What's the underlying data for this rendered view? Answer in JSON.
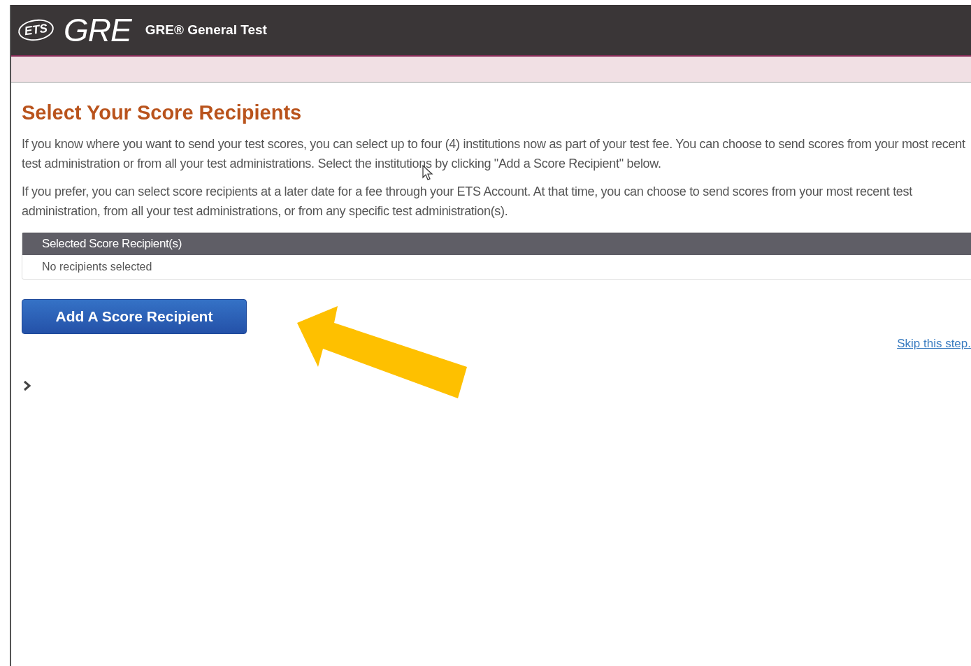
{
  "header": {
    "logo_mark": "ETS",
    "logo_word": "GRE",
    "title": "GRE® General Test"
  },
  "page": {
    "heading": "Select Your Score Recipients",
    "paragraphs": [
      "If you know where you want to send your test scores, you can select up to four (4) institutions now as part of your test fee. You can choose to send scores from your most recent test administration or from all your test administrations. Select the institutions by clicking \"Add a Score Recipient\" below.",
      "If you prefer, you can select score recipients at a later date for a fee through your ETS Account. At that time, you can choose to send scores from your most recent test administration, from all your test administrations, or from any specific test administration(s)."
    ],
    "table": {
      "header": "Selected Score Recipient(s)",
      "empty_text": "No recipients selected"
    },
    "add_button": "Add A Score Recipient",
    "skip_link": "Skip this step."
  }
}
